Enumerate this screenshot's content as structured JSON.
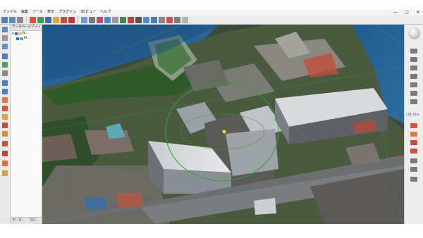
{
  "menu": [
    "ファイル",
    "編集",
    "ツール",
    "表示",
    "プラグイン",
    "3Dビュー",
    "ヘルプ"
  ],
  "window_controls": [
    "—",
    "□",
    "✕"
  ],
  "panel": {
    "title": "データベースツリー",
    "tree": [
      {
        "label": "W..."
      },
      {
        "label": "M..."
      }
    ]
  },
  "bottom_tabs": [
    "データ...",
    "プロ..."
  ],
  "right_panel": {
    "label": "CDE filter"
  }
}
